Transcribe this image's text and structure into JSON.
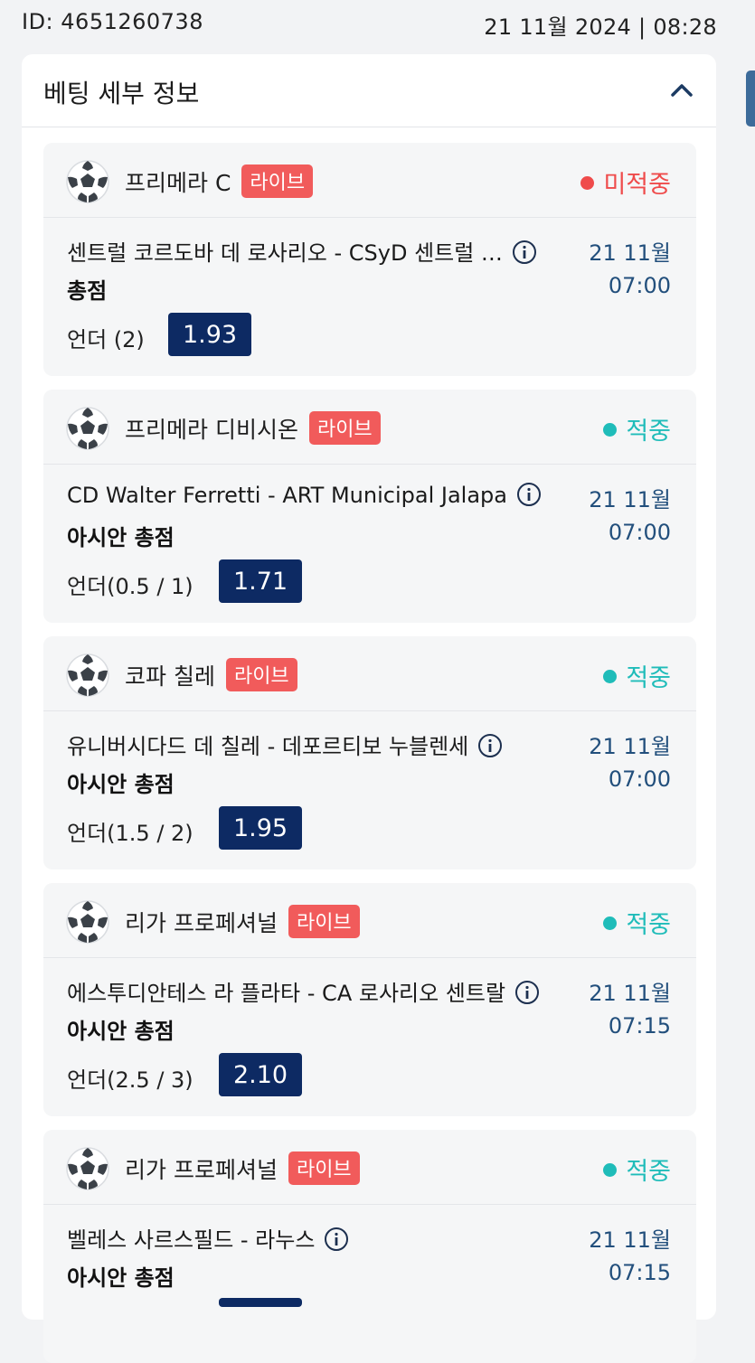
{
  "header": {
    "id_text": "ID: 4651260738",
    "datetime_text": "21 11월 2024 | 08:28"
  },
  "panel": {
    "title": "베팅 세부 정보"
  },
  "colors": {
    "odds_bg": "#0d2a63",
    "live_badge": "#f15b5b",
    "status_lose": "#ef4b4b",
    "status_win": "#1fbcb9"
  },
  "bets": [
    {
      "sport_icon": "soccer-ball-icon",
      "league": "프리메라 C",
      "live_label": "라이브",
      "status": "미적중",
      "match": "센트럴 코르도바 데 로사리오 - CSyD 센트럴 …",
      "market": "총점",
      "selection": "언더 (2)",
      "odds": "1.93",
      "date": "21 11월",
      "time": "07:00"
    },
    {
      "sport_icon": "soccer-ball-icon",
      "league": "프리메라 디비시온",
      "live_label": "라이브",
      "status": "적중",
      "match": "CD Walter Ferretti - ART Municipal Jalapa",
      "market": "아시안 총점",
      "selection": "언더(0.5 / 1)",
      "odds": "1.71",
      "date": "21 11월",
      "time": "07:00"
    },
    {
      "sport_icon": "soccer-ball-icon",
      "league": "코파 칠레",
      "live_label": "라이브",
      "status": "적중",
      "match": "유니버시다드 데 칠레 - 데포르티보 누블렌세",
      "market": "아시안 총점",
      "selection": "언더(1.5 / 2)",
      "odds": "1.95",
      "date": "21 11월",
      "time": "07:00"
    },
    {
      "sport_icon": "soccer-ball-icon",
      "league": "리가 프로페셔널",
      "live_label": "라이브",
      "status": "적중",
      "match": "에스투디안테스 라 플라타 - CA 로사리오 센트랄",
      "market": "아시안 총점",
      "selection": "언더(2.5 / 3)",
      "odds": "2.10",
      "date": "21 11월",
      "time": "07:15"
    },
    {
      "sport_icon": "soccer-ball-icon",
      "league": "리가 프로페셔널",
      "live_label": "라이브",
      "status": "적중",
      "match": "벨레스 사르스필드 - 라누스",
      "market": "아시안 총점",
      "selection": "",
      "odds": "",
      "date": "21 11월",
      "time": "07:15"
    }
  ]
}
